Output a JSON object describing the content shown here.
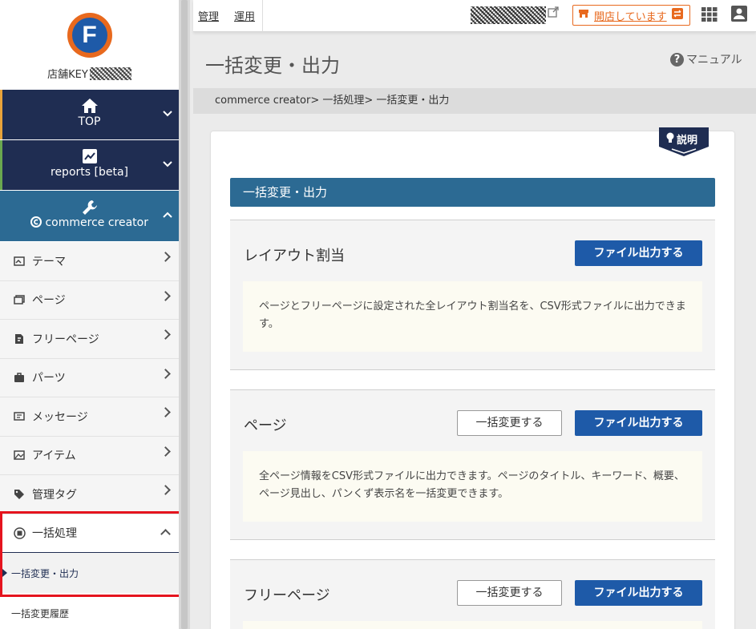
{
  "sidebar": {
    "store_key_label": "店舗KEY",
    "main_nav": [
      {
        "label": "TOP",
        "icon": "home-icon",
        "bar_color": "#e8a33a"
      },
      {
        "label": "reports [beta]",
        "icon": "chart-icon",
        "bar_color": "#6aa84f"
      },
      {
        "label": "commerce creator",
        "icon": "wrench-icon"
      }
    ],
    "sub_items": [
      {
        "label": "テーマ",
        "icon": "theme-icon"
      },
      {
        "label": "ページ",
        "icon": "page-icon"
      },
      {
        "label": "フリーページ",
        "icon": "free-page-icon"
      },
      {
        "label": "パーツ",
        "icon": "parts-icon"
      },
      {
        "label": "メッセージ",
        "icon": "message-icon"
      },
      {
        "label": "アイテム",
        "icon": "item-icon"
      },
      {
        "label": "管理タグ",
        "icon": "tag-icon"
      },
      {
        "label": "一括処理",
        "icon": "batch-icon"
      }
    ],
    "batch_children": [
      "一括変更・出力",
      "一括変更履歴"
    ]
  },
  "topbar": {
    "link_manage": "管理",
    "link_operate": "運用",
    "open_status": "開店しています"
  },
  "page": {
    "title": "一括変更・出力",
    "manual": "マニュアル",
    "breadcrumb": "commerce creator> 一括処理> 一括変更・出力",
    "explain_badge": "説明",
    "section_title": "一括変更・出力"
  },
  "blocks": [
    {
      "name": "レイアウト割当",
      "export_label": "ファイル出力する",
      "description": "ページとフリーページに設定された全レイアウト割当名を、CSV形式ファイルに出力できます。"
    },
    {
      "name": "ページ",
      "bulk_label": "一括変更する",
      "export_label": "ファイル出力する",
      "description": "全ページ情報をCSV形式ファイルに出力できます。ページのタイトル、キーワード、概要、ページ見出し、パンくず表示名を一括変更できます。"
    },
    {
      "name": "フリーページ",
      "bulk_label": "一括変更する",
      "export_label": "ファイル出力する"
    }
  ],
  "colors": {
    "navy": "#1f2d52",
    "teal": "#2c6a93",
    "primary": "#1e5aa8",
    "orange": "#e8691e",
    "highlight": "#e5141e"
  }
}
